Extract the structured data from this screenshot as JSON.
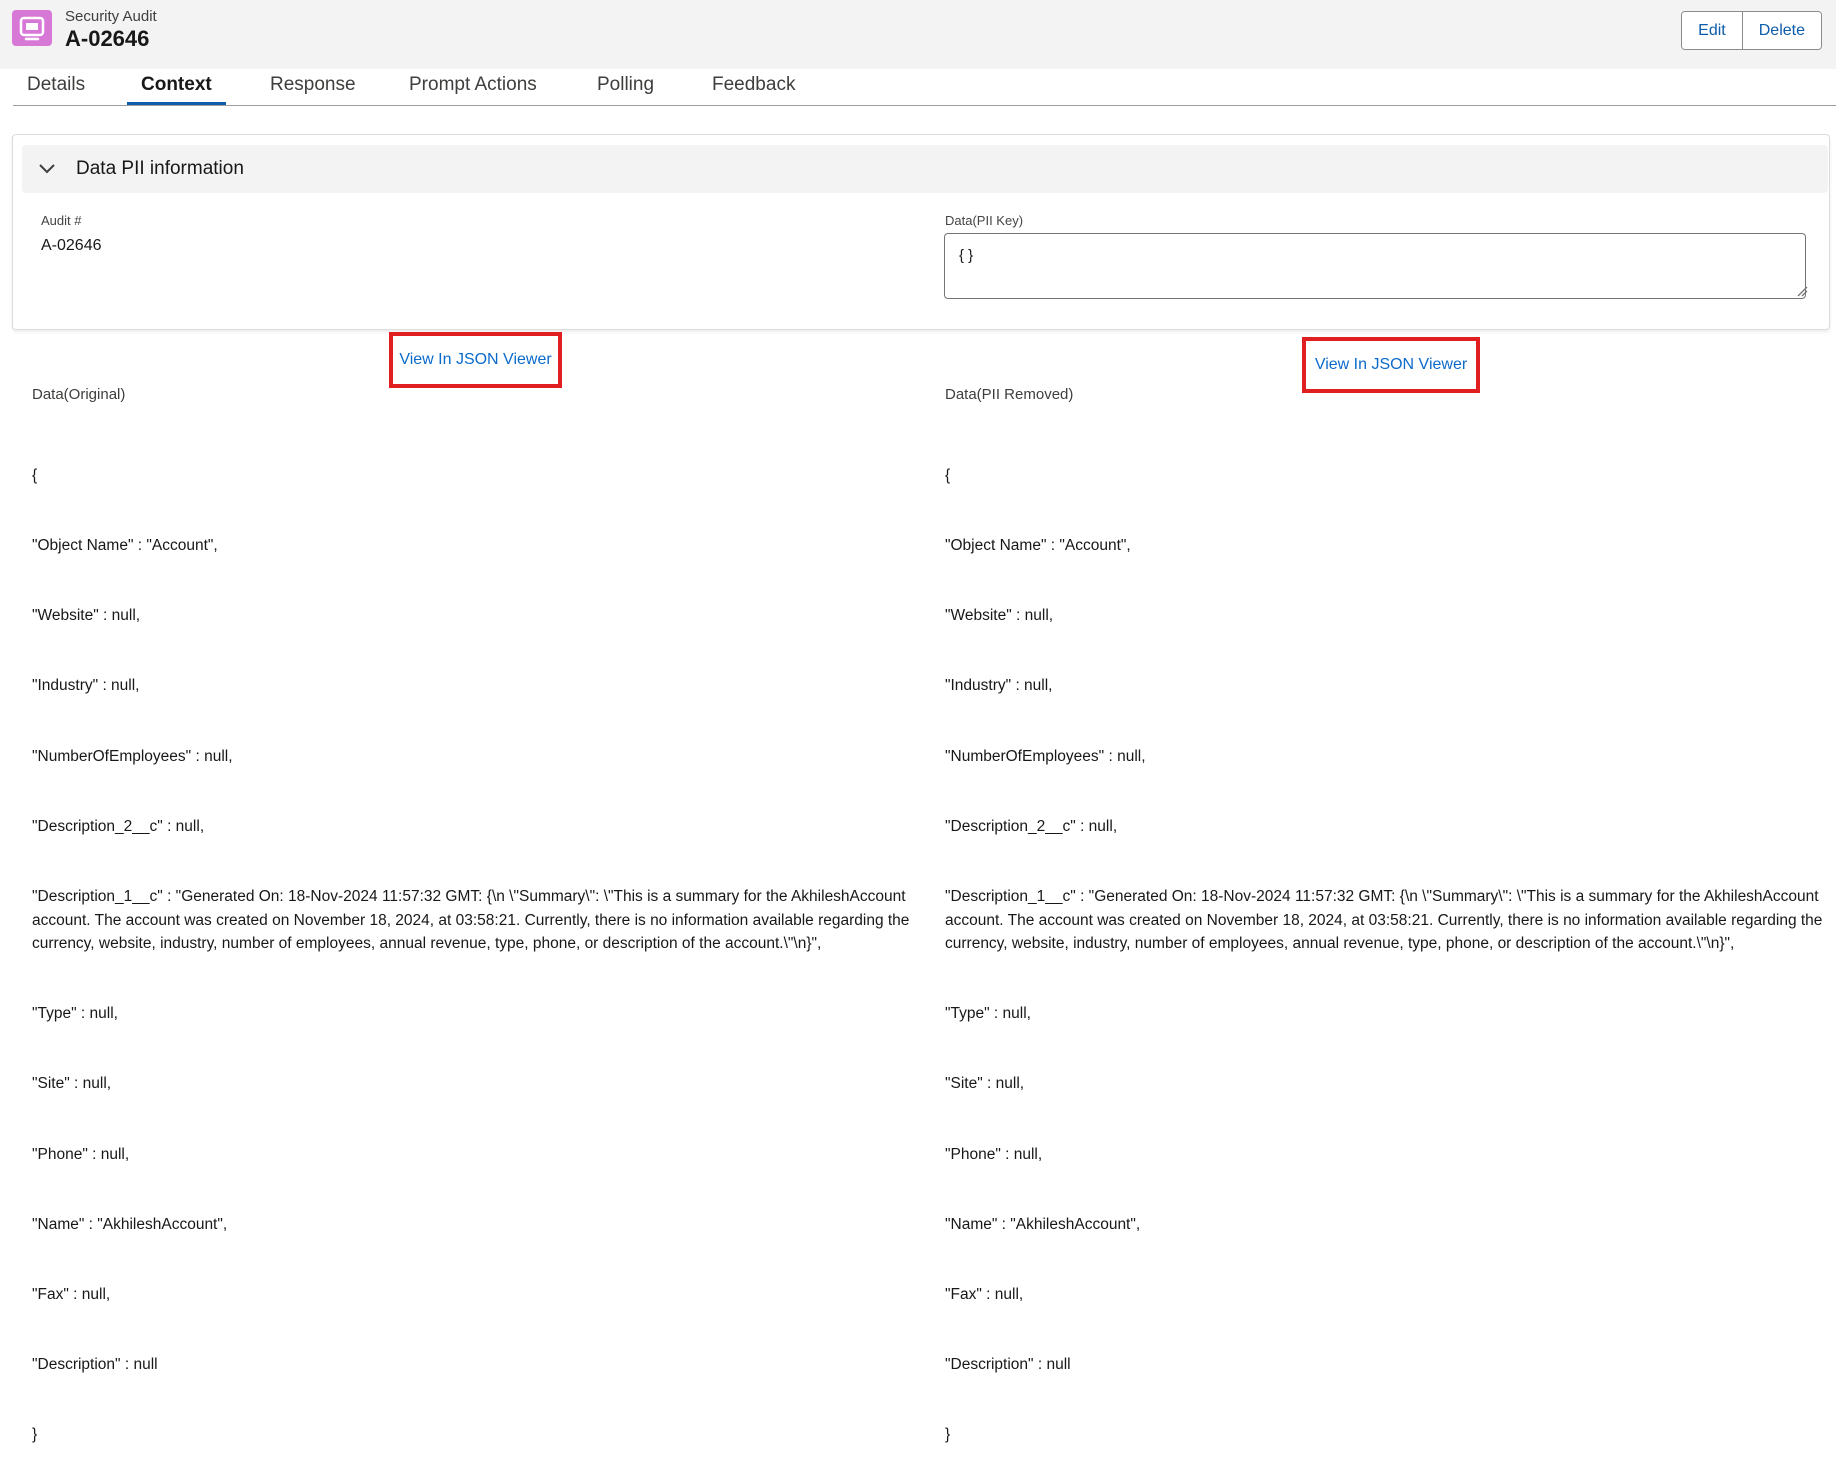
{
  "header": {
    "object_label": "Security Audit",
    "record_name": "A-02646",
    "app_icon": "record-icon",
    "accent_color": "#d878d6",
    "buttons": {
      "edit": "Edit",
      "delete": "Delete"
    }
  },
  "tabs": [
    {
      "label": "Details",
      "active": false
    },
    {
      "label": "Context",
      "active": true
    },
    {
      "label": "Response",
      "active": false
    },
    {
      "label": "Prompt Actions",
      "active": false
    },
    {
      "label": "Polling",
      "active": false
    },
    {
      "label": "Feedback",
      "active": false
    }
  ],
  "section": {
    "title": "Data PII information",
    "expanded": true,
    "audit_label": "Audit #",
    "audit_value": "A-02646",
    "pii_key_label": "Data(PII Key)",
    "pii_key_value": "{ }"
  },
  "original": {
    "link": "View In JSON Viewer",
    "label": "Data(Original)",
    "lines": [
      "{",
      "\"Object Name\" : \"Account\",",
      "\"Website\" : null,",
      "\"Industry\" : null,",
      "\"NumberOfEmployees\" : null,",
      "\"Description_2__c\" : null,",
      "\"Description_1__c\" : \"Generated On: 18-Nov-2024 11:57:32 GMT: {\\n \\\"Summary\\\": \\\"This is a summary for the AkhileshAccount account. The account was created on November 18, 2024, at 03:58:21. Currently, there is no information available regarding the currency, website, industry, number of employees, annual revenue, type, phone, or description of the account.\\\"\\n}\",",
      "\"Type\" : null,",
      "\"Site\" : null,",
      "\"Phone\" : null,",
      "\"Name\" : \"AkhileshAccount\",",
      "\"Fax\" : null,",
      "\"Description\" : null",
      "}"
    ]
  },
  "removed": {
    "link": "View In JSON Viewer",
    "label": "Data(PII Removed)",
    "lines": [
      "{",
      "\"Object Name\" : \"Account\",",
      "\"Website\" : null,",
      "\"Industry\" : null,",
      "\"NumberOfEmployees\" : null,",
      "\"Description_2__c\" : null,",
      "\"Description_1__c\" : \"Generated On: 18-Nov-2024 11:57:32 GMT: {\\n \\\"Summary\\\": \\\"This is a summary for the AkhileshAccount account. The account was created on November 18, 2024, at 03:58:21. Currently, there is no information available regarding the currency, website, industry, number of employees, annual revenue, type, phone, or description of the account.\\\"\\n}\",",
      "\"Type\" : null,",
      "\"Site\" : null,",
      "\"Phone\" : null,",
      "\"Name\" : \"AkhileshAccount\",",
      "\"Fax\" : null,",
      "\"Description\" : null",
      "}"
    ]
  }
}
